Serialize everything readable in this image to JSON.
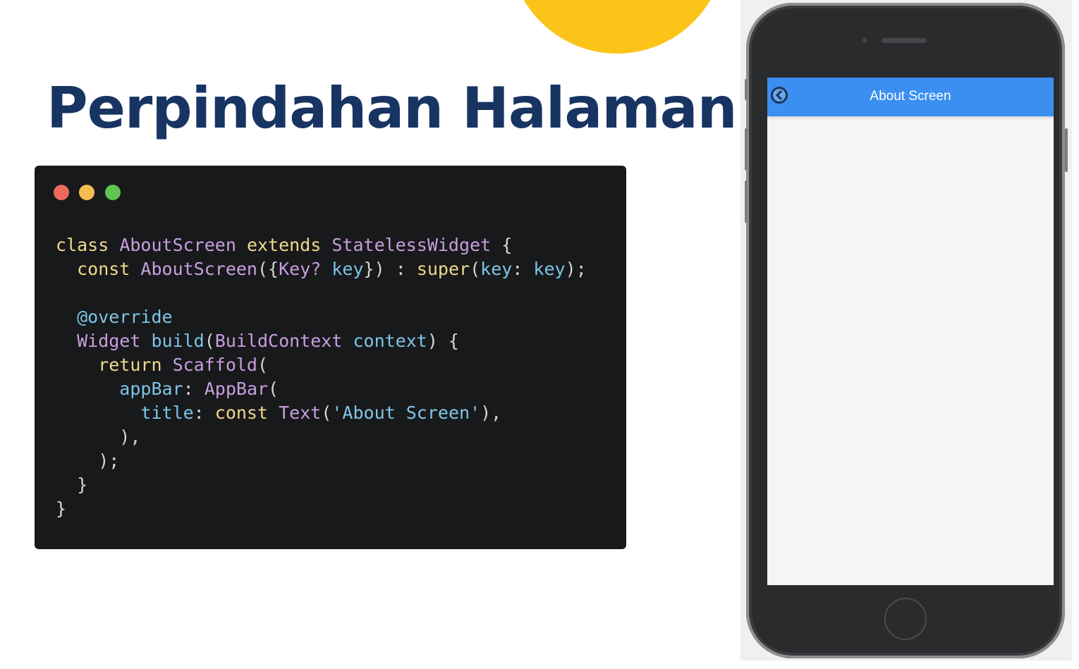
{
  "page": {
    "title": "Perpindahan Halaman"
  },
  "code_window": {
    "lines": [
      [
        {
          "t": "class ",
          "c": "kw"
        },
        {
          "t": "AboutScreen ",
          "c": "cls"
        },
        {
          "t": "extends ",
          "c": "kw"
        },
        {
          "t": "StatelessWidget ",
          "c": "cls"
        },
        {
          "t": "{",
          "c": "pn"
        }
      ],
      [
        {
          "t": "  const ",
          "c": "kw"
        },
        {
          "t": "AboutScreen",
          "c": "cls"
        },
        {
          "t": "({",
          "c": "pn"
        },
        {
          "t": "Key?",
          "c": "cls"
        },
        {
          "t": " key",
          "c": "var"
        },
        {
          "t": "}) : ",
          "c": "pn"
        },
        {
          "t": "super",
          "c": "kw"
        },
        {
          "t": "(",
          "c": "pn"
        },
        {
          "t": "key",
          "c": "var"
        },
        {
          "t": ": ",
          "c": "pn"
        },
        {
          "t": "key",
          "c": "var"
        },
        {
          "t": ");",
          "c": "pn"
        }
      ],
      [],
      [
        {
          "t": "  @override",
          "c": "var"
        }
      ],
      [
        {
          "t": "  Widget ",
          "c": "cls"
        },
        {
          "t": "build",
          "c": "var"
        },
        {
          "t": "(",
          "c": "pn"
        },
        {
          "t": "BuildContext ",
          "c": "cls"
        },
        {
          "t": "context",
          "c": "var"
        },
        {
          "t": ") {",
          "c": "pn"
        }
      ],
      [
        {
          "t": "    return ",
          "c": "kw"
        },
        {
          "t": "Scaffold",
          "c": "cls"
        },
        {
          "t": "(",
          "c": "pn"
        }
      ],
      [
        {
          "t": "      appBar",
          "c": "var"
        },
        {
          "t": ": ",
          "c": "pn"
        },
        {
          "t": "AppBar",
          "c": "cls"
        },
        {
          "t": "(",
          "c": "pn"
        }
      ],
      [
        {
          "t": "        title",
          "c": "var"
        },
        {
          "t": ": ",
          "c": "pn"
        },
        {
          "t": "const ",
          "c": "kw"
        },
        {
          "t": "Text",
          "c": "cls"
        },
        {
          "t": "(",
          "c": "pn"
        },
        {
          "t": "'About Screen'",
          "c": "str"
        },
        {
          "t": "),",
          "c": "pn"
        }
      ],
      [
        {
          "t": "      ),",
          "c": "pn"
        }
      ],
      [
        {
          "t": "    );",
          "c": "pn"
        }
      ],
      [
        {
          "t": "  }",
          "c": "pn"
        }
      ],
      [
        {
          "t": "}",
          "c": "pn"
        }
      ]
    ]
  },
  "phone": {
    "appbar_title": "About Screen",
    "back_icon": "back-arrow-icon"
  },
  "colors": {
    "title": "#183462",
    "accent_circle": "#fcc419",
    "appbar": "#3b8ff0",
    "code_bg": "#18191b"
  }
}
